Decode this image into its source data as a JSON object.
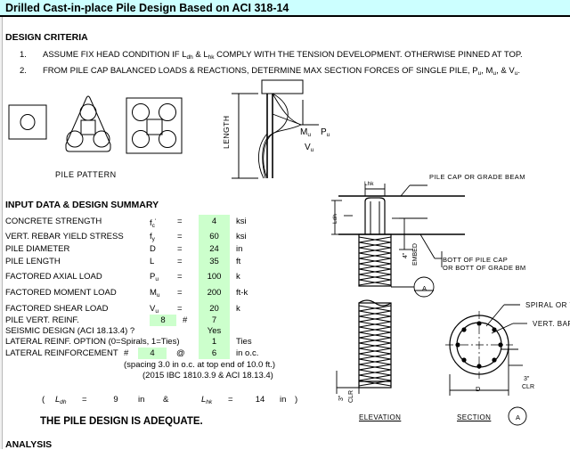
{
  "title": "Drilled Cast-in-place Pile Design Based on ACI 318-14",
  "sections": {
    "design_criteria": "DESIGN CRITERIA",
    "input_summary": "INPUT DATA & DESIGN SUMMARY",
    "analysis": "ANALYSIS"
  },
  "criteria": [
    {
      "num": "1.",
      "text_a": "ASSUME FIX HEAD CONDITION IF L",
      "sub_a": "dh",
      "text_b": " & L",
      "sub_b": "hk",
      "text_c": " COMPLY WITH THE TENSION DEVELOPMENT. OTHERWISE PINNED AT TOP."
    },
    {
      "num": "2.",
      "text_a": "FROM PILE CAP BALANCED LOADS & REACTIONS, DETERMINE MAX SECTION FORCES OF SINGLE PILE, P",
      "sub_a": "u",
      "text_b": ", M",
      "sub_b": "u",
      "text_c": ", & V",
      "sub_c": "u",
      "text_d": "."
    }
  ],
  "pile_pattern": {
    "caption": "PILE  PATTERN"
  },
  "force_diagram": {
    "length_label": "LENGTH",
    "mu": "M",
    "mu_sub": "u",
    "pu": "P",
    "pu_sub": "u",
    "vu": "V",
    "vu_sub": "u"
  },
  "inputs": [
    {
      "label": "CONCRETE STRENGTH",
      "sym": "f",
      "sym_sub": "c",
      "sym_sup": "'",
      "eq": "=",
      "value": "4",
      "unit": "ksi"
    },
    {
      "label": "VERT. REBAR YIELD STRESS",
      "sym": "f",
      "sym_sub": "y",
      "sym_sup": "",
      "eq": "=",
      "value": "60",
      "unit": "ksi"
    },
    {
      "label": "PILE DIAMETER",
      "sym": "D",
      "sym_sub": "",
      "sym_sup": "",
      "eq": "=",
      "value": "24",
      "unit": "in"
    },
    {
      "label": "PILE LENGTH",
      "sym": "L",
      "sym_sub": "",
      "sym_sup": "",
      "eq": "=",
      "value": "35",
      "unit": "ft"
    },
    {
      "label": "FACTORED AXIAL LOAD",
      "sym": "P",
      "sym_sub": "u",
      "sym_sup": "",
      "eq": "=",
      "value": "100",
      "unit": "k"
    },
    {
      "label": "FACTORED MOMENT LOAD",
      "sym": "M",
      "sym_sub": "u",
      "sym_sup": "",
      "eq": "=",
      "value": "200",
      "unit": "ft-k"
    },
    {
      "label": "FACTORED SHEAR LOAD",
      "sym": "V",
      "sym_sub": "u",
      "sym_sup": "",
      "eq": "=",
      "value": "20",
      "unit": "k"
    }
  ],
  "reinf": {
    "vert_label": "PILE VERT. REINF.",
    "vert_count": "8",
    "hash": "#",
    "vert_size": "7",
    "seismic_label": "SEISMIC DESIGN (ACI 18.13.4) ?",
    "seismic_value": "Yes",
    "lat_option_label": "LATERAL REINF. OPTION (0=Spirals, 1=Ties)",
    "lat_option_value": "1",
    "lat_option_text": "Ties",
    "lat_label": "LATERAL REINFORCEMENT",
    "lat_hash": "#",
    "lat_size": "4",
    "at": "@",
    "lat_spacing": "6",
    "lat_unit": "in o.c.",
    "note1": "(spacing 3.0 in o.c. at top end of 10.0 ft.)",
    "note2": "(2015 IBC 1810.3.9 & ACI 18.13.4)"
  },
  "development": {
    "open": "(",
    "ldh_sym": "L",
    "ldh_sub": "dh",
    "ldh_eq": "=",
    "ldh_value": "9",
    "ldh_unit": "in",
    "amp": "&",
    "lhk_sym": "L",
    "lhk_sub": "hk",
    "lhk_eq": "=",
    "lhk_value": "14",
    "lhk_unit": "in",
    "close": ")"
  },
  "verdict": "THE PILE DESIGN IS ADEQUATE.",
  "elevation": {
    "title": "ELEVATION",
    "pile_cap_note": "PILE CAP OR GRADE BEAM",
    "bott_note_1": "BOTT OF PILE CAP",
    "bott_note_2": "OR BOTT OF GRADE BM",
    "lhk_dim": "Lhk",
    "ldh_dim": "Ldh",
    "embed_dim": "4\"",
    "embed_label": "EMBED",
    "clr_dim": "3\"",
    "clr_label": "CLR",
    "bubble": "A"
  },
  "section": {
    "title": "SECTION",
    "bubble": "A",
    "spiral_note": "SPIRAL  OR  TIES",
    "vert_note": "VERT.  BARS",
    "clr_dim": "3\"",
    "clr_label": "CLR",
    "dia_label": "D"
  },
  "colors": {
    "title_bg": "#ccffff",
    "input_cell": "#ccffcc",
    "line": "#000000"
  }
}
